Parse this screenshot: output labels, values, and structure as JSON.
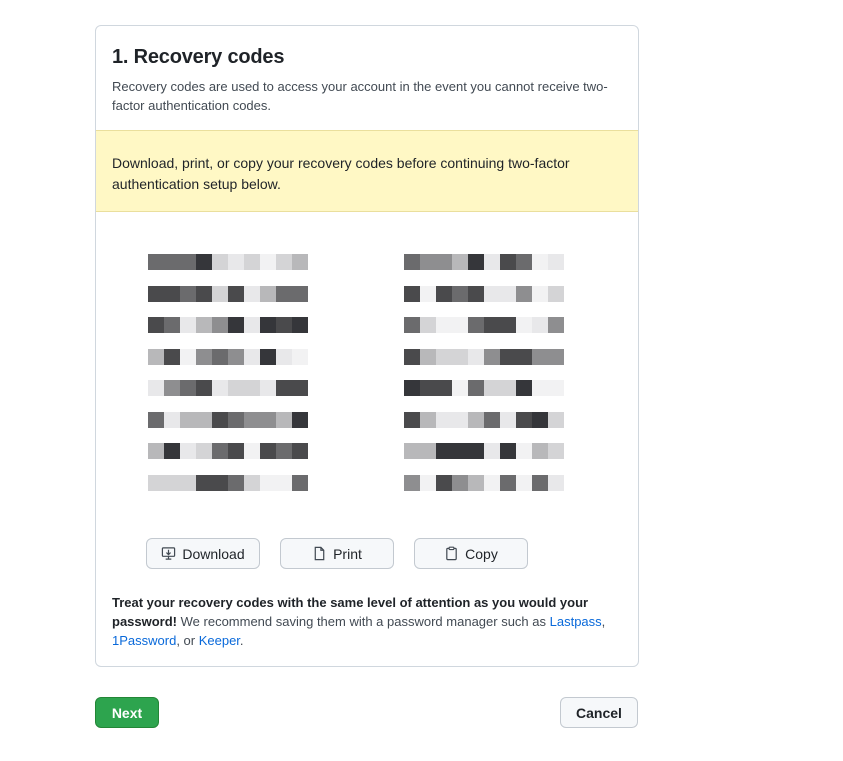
{
  "card": {
    "title": "1. Recovery codes",
    "description": "Recovery codes are used to access your account in the event you cannot receive two-factor authentication codes."
  },
  "warning": {
    "text": "Download, print, or copy your recovery codes before continuing two-factor authentication setup below."
  },
  "codes": {
    "left": [
      "████████████",
      "████████████",
      "████████████",
      "████████████",
      "████████████",
      "████████████",
      "████████████",
      "████████████"
    ],
    "right": [
      "████████████",
      "████████████",
      "████████████",
      "████████████",
      "████████████",
      "████████████",
      "████████████",
      "████████████"
    ],
    "blurred": true
  },
  "actions": {
    "download_label": "Download",
    "print_label": "Print",
    "copy_label": "Copy",
    "download_icon": "download-icon",
    "print_icon": "file-icon",
    "copy_icon": "clipboard-icon"
  },
  "note": {
    "bold": "Treat your recovery codes with the same level of attention as you would your password!",
    "text": " We recommend saving them with a password manager such as ",
    "link1": "Lastpass",
    "sep1": ", ",
    "link2": "1Password",
    "sep2": ", or ",
    "link3": "Keeper",
    "end": "."
  },
  "footer": {
    "next_label": "Next",
    "cancel_label": "Cancel"
  },
  "colors": {
    "primary": "#2da44e",
    "warning_bg": "#fff8c5",
    "link": "#0969da"
  }
}
